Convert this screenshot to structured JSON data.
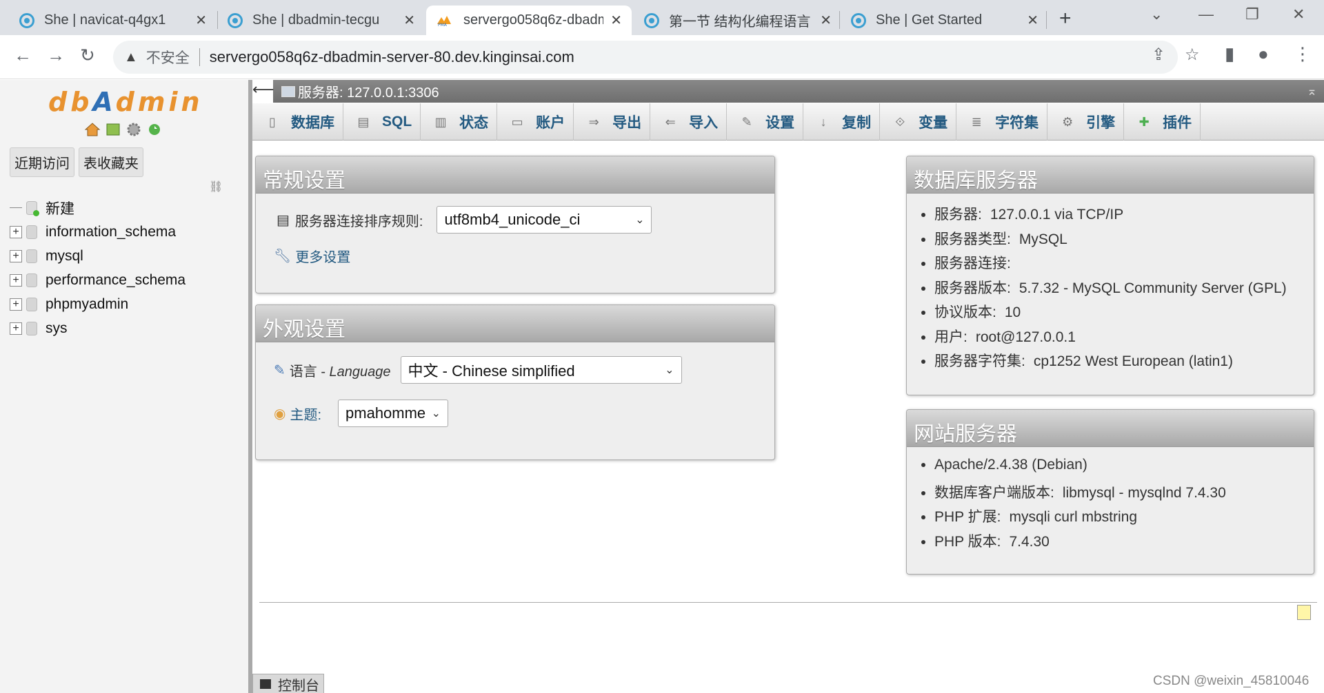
{
  "browser": {
    "tabs": [
      {
        "title": "She | navicat-q4gx1"
      },
      {
        "title": "She | dbadmin-tecgu"
      },
      {
        "title": "servergo058q6z-dbadm"
      },
      {
        "title": "第一节 结构化编程语言 -"
      },
      {
        "title": "She | Get Started"
      }
    ],
    "active_tab": 2,
    "insecure_label": "不安全",
    "url": "servergo058q6z-dbadmin-server-80.dev.kinginsai.com"
  },
  "sidebar": {
    "logo_parts": [
      "db",
      "A",
      "dmin"
    ],
    "tabs": [
      "近期访问",
      "表收藏夹"
    ],
    "new_label": "新建",
    "databases": [
      "information_schema",
      "mysql",
      "performance_schema",
      "phpmyadmin",
      "sys"
    ]
  },
  "server_bar": {
    "label": "服务器: 127.0.0.1:3306"
  },
  "menu": [
    "数据库",
    "SQL",
    "状态",
    "账户",
    "导出",
    "导入",
    "设置",
    "复制",
    "变量",
    "字符集",
    "引擎",
    "插件"
  ],
  "general_settings": {
    "title": "常规设置",
    "collation_label": "服务器连接排序规则:",
    "collation_value": "utf8mb4_unicode_ci",
    "more_settings": "更多设置"
  },
  "appearance_settings": {
    "title": "外观设置",
    "language_label": "语言 - ",
    "language_label_en": "Language",
    "language_value": "中文 - Chinese simplified",
    "theme_label": "主题:",
    "theme_value": "pmahomme"
  },
  "db_server": {
    "title": "数据库服务器",
    "items": [
      {
        "label": "服务器:",
        "value": "127.0.0.1 via TCP/IP"
      },
      {
        "label": "服务器类型:",
        "value": "MySQL"
      },
      {
        "label": "服务器连接:",
        "value": ""
      },
      {
        "label": "服务器版本:",
        "value": "5.7.32 - MySQL Community Server (GPL)"
      },
      {
        "label": "协议版本:",
        "value": "10"
      },
      {
        "label": "用户:",
        "value": "root@127.0.0.1"
      },
      {
        "label": "服务器字符集:",
        "value": "cp1252 West European (latin1)"
      }
    ]
  },
  "web_server": {
    "title": "网站服务器",
    "items": [
      {
        "label": "Apache/2.4.38 (Debian)",
        "value": ""
      },
      {
        "label": "数据库客户端版本:",
        "value": "libmysql - mysqlnd 7.4.30"
      },
      {
        "label": "PHP 扩展:",
        "value": "mysqli curl mbstring"
      },
      {
        "label": "PHP 版本:",
        "value": "7.4.30"
      }
    ]
  },
  "console_label": "控制台",
  "watermark": "CSDN @weixin_45810046"
}
